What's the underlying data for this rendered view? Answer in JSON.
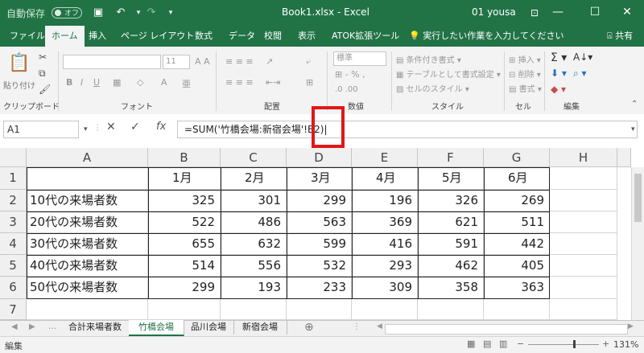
{
  "titlebar": {
    "autosave_label": "自動保存",
    "autosave_state": "オフ",
    "file_title": "Book1.xlsx",
    "separator": "-",
    "app_name": "Excel",
    "user": "01 yousa"
  },
  "tabs": [
    "ファイル",
    "ホーム",
    "挿入",
    "ページ レイアウト",
    "数式",
    "データ",
    "校閲",
    "表示",
    "ATOK拡張ツール"
  ],
  "tell_me": "実行したい作業を入力してください",
  "share": "共有",
  "ribbon": {
    "paste_label": "貼り付け",
    "font_size": "11",
    "number_format": "標準",
    "cond_format": "条件付き書式",
    "table_format": "テーブルとして書式設定",
    "cell_style": "セルのスタイル",
    "insert": "挿入",
    "delete": "削除",
    "format": "書式",
    "groups": {
      "clipboard": "クリップボード",
      "font": "フォント",
      "alignment": "配置",
      "number": "数値",
      "styles": "スタイル",
      "cells": "セル",
      "editing": "編集"
    }
  },
  "formula_bar": {
    "name_box": "A1",
    "cancel": "✕",
    "enter": "✓",
    "fx": "fx",
    "formula": "=SUM('竹橋会場:新宿会場'!B2)"
  },
  "sheet": {
    "columns": [
      "A",
      "B",
      "C",
      "D",
      "E",
      "F",
      "G",
      "H"
    ],
    "row_numbers": [
      "1",
      "2",
      "3",
      "4",
      "5",
      "6",
      "7"
    ],
    "months": [
      "1月",
      "2月",
      "3月",
      "4月",
      "5月",
      "6月"
    ],
    "rows": [
      {
        "label": "10代の来場者数",
        "values": [
          "325",
          "301",
          "299",
          "196",
          "326",
          "269"
        ]
      },
      {
        "label": "20代の来場者数",
        "values": [
          "522",
          "486",
          "563",
          "369",
          "621",
          "511"
        ]
      },
      {
        "label": "30代の来場者数",
        "values": [
          "655",
          "632",
          "599",
          "416",
          "591",
          "442"
        ]
      },
      {
        "label": "40代の来場者数",
        "values": [
          "514",
          "556",
          "532",
          "293",
          "462",
          "405"
        ]
      },
      {
        "label": "50代の来場者数",
        "values": [
          "299",
          "193",
          "233",
          "309",
          "358",
          "363"
        ]
      }
    ]
  },
  "sheet_tabs": [
    "合計来場者数",
    "竹橋会場",
    "品川会場",
    "新宿会場"
  ],
  "active_sheet": "竹橋会場",
  "status": {
    "mode": "編集",
    "zoom": "131%"
  }
}
